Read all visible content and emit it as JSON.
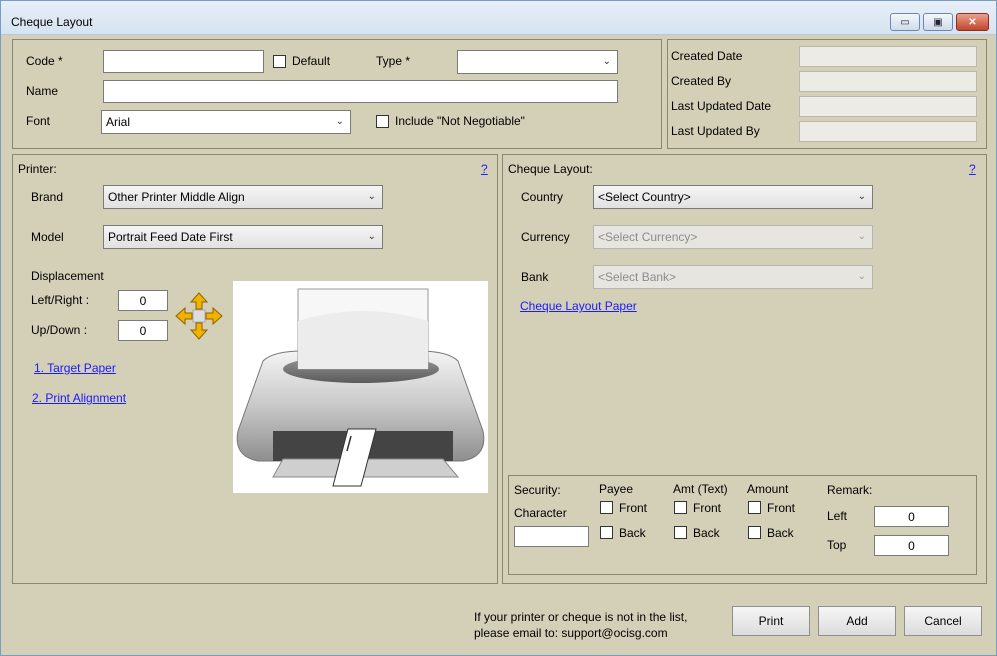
{
  "window": {
    "title": "Cheque Layout"
  },
  "titlebar_buttons": {
    "minimize": "▭",
    "maximize": "▣",
    "close": "✕"
  },
  "header": {
    "code_label": "Code *",
    "code_value": "",
    "default_label": "Default",
    "type_label": "Type *",
    "type_value": "",
    "name_label": "Name",
    "name_value": "",
    "font_label": "Font",
    "font_value": "Arial",
    "not_negotiable_label": "Include \"Not Negotiable\""
  },
  "audit": {
    "created_date_label": "Created Date",
    "created_by_label": "Created By",
    "last_updated_date_label": "Last Updated Date",
    "last_updated_by_label": "Last Updated By"
  },
  "printer": {
    "section_label": "Printer:",
    "help": "?",
    "brand_label": "Brand",
    "brand_value": "Other Printer Middle Align",
    "model_label": "Model",
    "model_value": "Portrait Feed Date First",
    "displacement_label": "Displacement",
    "left_right_label": "Left/Right :",
    "left_right_value": "0",
    "up_down_label": "Up/Down :",
    "up_down_value": "0",
    "link_target_paper": "1. Target Paper",
    "link_print_alignment": "2. Print Alignment"
  },
  "layout": {
    "section_label": "Cheque Layout:",
    "help": "?",
    "country_label": "Country",
    "country_value": "<Select Country>",
    "currency_label": "Currency",
    "currency_value": "<Select Currency>",
    "bank_label": "Bank",
    "bank_value": "<Select Bank>",
    "link_paper": "Cheque Layout Paper"
  },
  "security": {
    "security_label": "Security:",
    "character_label": "Character",
    "character_value": "",
    "payee_label": "Payee",
    "amt_text_label": "Amt (Text)",
    "amount_label": "Amount",
    "front_label": "Front",
    "back_label": "Back",
    "remark_label": "Remark:",
    "left_label": "Left",
    "left_value": "0",
    "top_label": "Top",
    "top_value": "0"
  },
  "footer": {
    "note_line1": "If your printer or cheque is not in the list,",
    "note_line2": "please email to: support@ocisg.com",
    "print_label": "Print",
    "add_label": "Add",
    "cancel_label": "Cancel"
  }
}
